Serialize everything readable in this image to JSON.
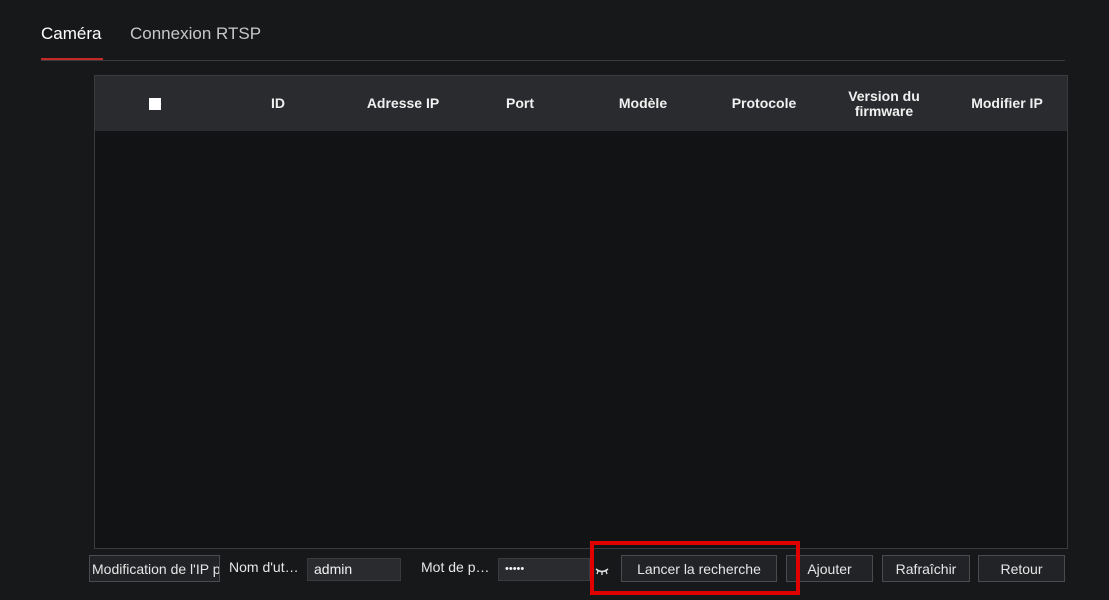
{
  "tabs": [
    {
      "label": "Caméra",
      "active": true
    },
    {
      "label": "Connexion RTSP",
      "active": false
    }
  ],
  "table": {
    "columns": [
      "ID",
      "Adresse IP",
      "Port",
      "Modèle",
      "Protocole",
      "Version du firmware",
      "Modifier IP"
    ],
    "rows": []
  },
  "footer": {
    "modify_ip_button": "Modification de l'IP p",
    "username_label": "Nom d'ut…",
    "username_value": "admin",
    "password_label": "Mot de p…",
    "password_value": "•••••",
    "search_button": "Lancer la recherche",
    "add_button": "Ajouter",
    "refresh_button": "Rafraîchir",
    "back_button": "Retour"
  },
  "colors": {
    "accent": "#c62828",
    "highlight": "#e00000",
    "background": "#17181a",
    "header": "#2a2b2e"
  },
  "icons": [
    "checkbox",
    "eye-hidden-icon"
  ]
}
